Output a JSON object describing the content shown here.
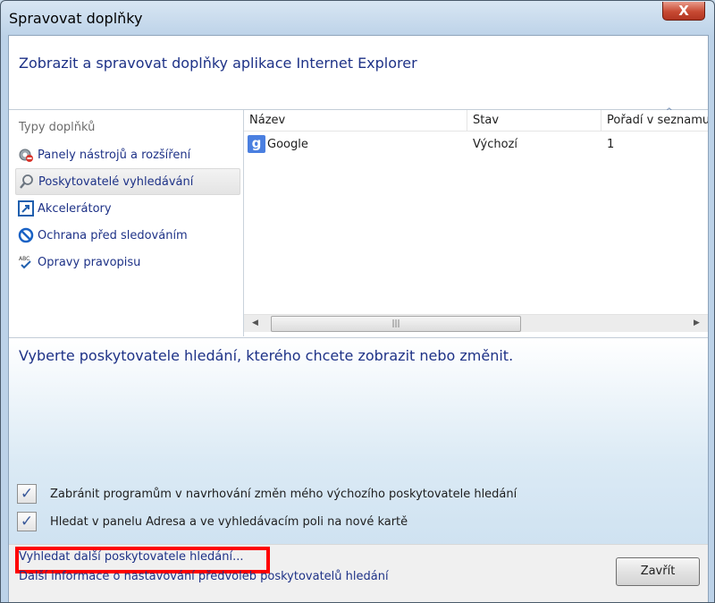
{
  "window": {
    "title": "Spravovat doplňky",
    "close_glyph": "X"
  },
  "header": {
    "title": "Zobrazit a spravovat doplňky aplikace Internet Explorer"
  },
  "addon_types": {
    "label": "Typy doplňků",
    "items": [
      {
        "label": "Panely nástrojů a rozšíření",
        "icon": "gear-puzzle-icon"
      },
      {
        "label": "Poskytovatelé vyhledávání",
        "icon": "search-icon",
        "selected": true
      },
      {
        "label": "Akcelerátory",
        "icon": "accelerator-icon"
      },
      {
        "label": "Ochrana před sledováním",
        "icon": "no-entry-icon"
      },
      {
        "label": "Opravy pravopisu",
        "icon": "spellcheck-icon"
      }
    ]
  },
  "table": {
    "columns": [
      "Název",
      "Stav",
      "Pořadí v seznamu"
    ],
    "sort_glyph": "^",
    "rows": [
      {
        "name": "Google",
        "status": "Výchozí",
        "order": "1",
        "icon_letter": "g"
      }
    ],
    "scroll_left": "◀",
    "scroll_right": "▶",
    "thumb_grip": "|||"
  },
  "details": {
    "title": "Vyberte poskytovatele hledání, kterého chcete zobrazit nebo změnit.",
    "checkboxes": [
      {
        "label": "Zabránit programům v navrhování změn mého výchozího poskytovatele hledání",
        "checked": true
      },
      {
        "label": "Hledat v panelu Adresa a ve vyhledávacím poli na nové kartě",
        "checked": true
      }
    ],
    "check_glyph": "✓"
  },
  "footer": {
    "link_find_more": "Vyhledat další poskytovatele hledání...",
    "link_more_info": "Další informace o nastavování předvoleb poskytovatelů hledání",
    "close_button": "Zavřít"
  },
  "colors": {
    "accent_text": "#1e3287",
    "highlight": "#ff0000",
    "close_red": "#c74a33"
  }
}
